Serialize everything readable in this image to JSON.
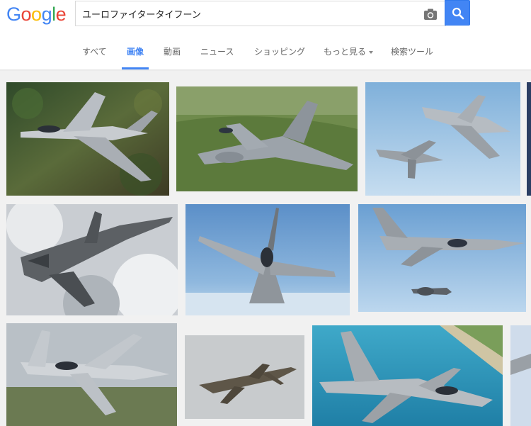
{
  "logo": {
    "text": "Google",
    "letters": [
      "G",
      "o",
      "o",
      "g",
      "l",
      "e"
    ],
    "colors": [
      "#4285f4",
      "#ea4335",
      "#fbbc05",
      "#4285f4",
      "#34a853",
      "#ea4335"
    ]
  },
  "search": {
    "query": "ユーロファイタータイフーン",
    "camera_icon": "camera-icon",
    "search_icon": "search-icon",
    "accent": "#4285f4"
  },
  "tabs": [
    {
      "label": "すべて",
      "active": false
    },
    {
      "label": "画像",
      "active": true
    },
    {
      "label": "動画",
      "active": false
    },
    {
      "label": "ニュース",
      "active": false
    },
    {
      "label": "ショッピング",
      "active": false
    },
    {
      "label": "もっと見る",
      "active": false,
      "dropdown": true
    },
    {
      "label": "検索ツール",
      "active": false
    }
  ],
  "results": {
    "subject": "Eurofighter Typhoon aircraft photos",
    "count_visible": 10
  }
}
